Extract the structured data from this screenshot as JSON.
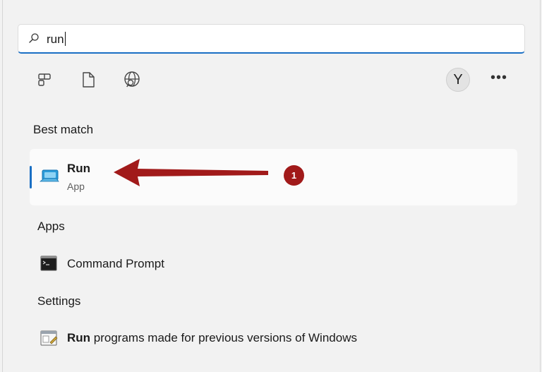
{
  "search": {
    "query": "run"
  },
  "toolbar": {
    "icons": [
      "apps-icon",
      "document-icon",
      "web-search-icon"
    ],
    "avatar_letter": "Y",
    "more_label": "•••"
  },
  "best_match": {
    "heading": "Best match",
    "title": "Run",
    "subtitle": "App"
  },
  "apps": {
    "heading": "Apps",
    "items": [
      {
        "label": "Command Prompt"
      }
    ]
  },
  "settings": {
    "heading": "Settings",
    "items": [
      {
        "label_bold": "Run",
        "label_rest": " programs made for previous versions of Windows"
      }
    ]
  },
  "annotation": {
    "step": "1",
    "color": "#a11a1a"
  },
  "colors": {
    "accent": "#1a6fc4",
    "panel": "#f2f2f2"
  }
}
